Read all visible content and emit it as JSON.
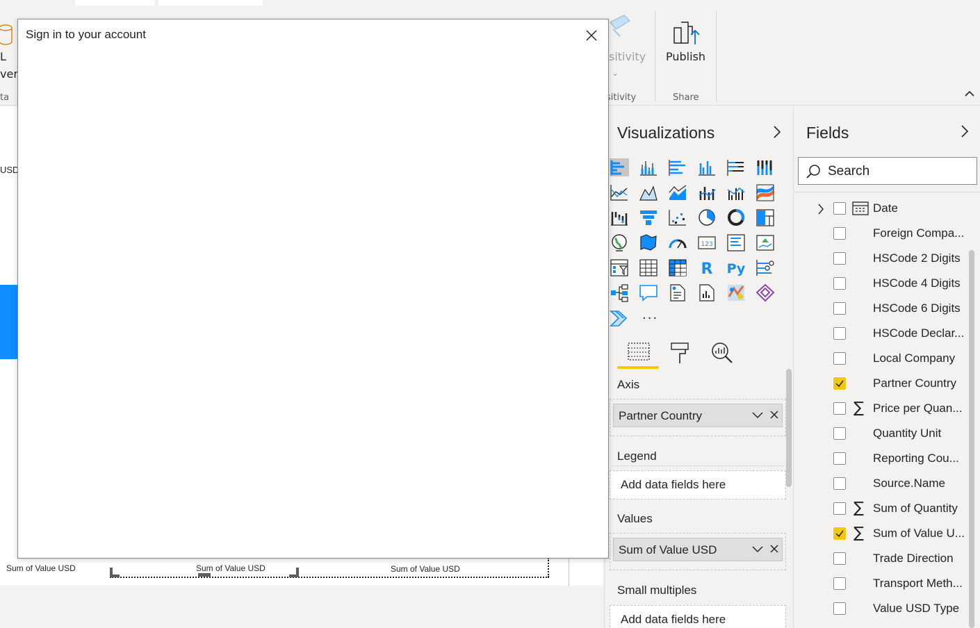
{
  "ribbon": {
    "sensitivity_label": "sitivity",
    "sensitivity_group": "sitivity",
    "publish_label": "Publish",
    "share_group": "Share",
    "left_cut_labels": [
      "L",
      "ver",
      "ta"
    ]
  },
  "canvas": {
    "axis_labels": [
      "Sum of Value USD",
      "Sum of Value USD",
      "Sum of Value USD"
    ],
    "side_label": "USD"
  },
  "dialog": {
    "title": "Sign in to your account"
  },
  "visualizations": {
    "title": "Visualizations",
    "more": "···",
    "wells": {
      "axis_label": "Axis",
      "axis_value": "Partner Country",
      "legend_label": "Legend",
      "legend_placeholder": "Add data fields here",
      "values_label": "Values",
      "values_value": "Sum of Value USD",
      "small_multiples_label": "Small multiples",
      "small_multiples_placeholder": "Add data fields here"
    }
  },
  "fields": {
    "title": "Fields",
    "search_placeholder": "Search",
    "items": [
      {
        "name": "Date",
        "checked": false,
        "expandable": true,
        "calendar": true
      },
      {
        "name": "Foreign Compa...",
        "checked": false
      },
      {
        "name": "HSCode 2 Digits",
        "checked": false
      },
      {
        "name": "HSCode 4 Digits",
        "checked": false
      },
      {
        "name": "HSCode 6 Digits",
        "checked": false
      },
      {
        "name": "HSCode Declar...",
        "checked": false
      },
      {
        "name": "Local Company",
        "checked": false
      },
      {
        "name": "Partner Country",
        "checked": true
      },
      {
        "name": "Price per Quan...",
        "checked": false,
        "sigma": true
      },
      {
        "name": "Quantity Unit",
        "checked": false
      },
      {
        "name": "Reporting Cou...",
        "checked": false
      },
      {
        "name": "Source.Name",
        "checked": false
      },
      {
        "name": "Sum of Quantity",
        "checked": false,
        "sigma": true
      },
      {
        "name": "Sum of Value U...",
        "checked": true,
        "sigma": true
      },
      {
        "name": "Trade Direction",
        "checked": false
      },
      {
        "name": "Transport Meth...",
        "checked": false
      },
      {
        "name": "Value USD Type",
        "checked": false
      }
    ]
  },
  "colors": {
    "accent": "#f2c811",
    "viz_blue": "#118dff",
    "selection": "#0078d4"
  }
}
